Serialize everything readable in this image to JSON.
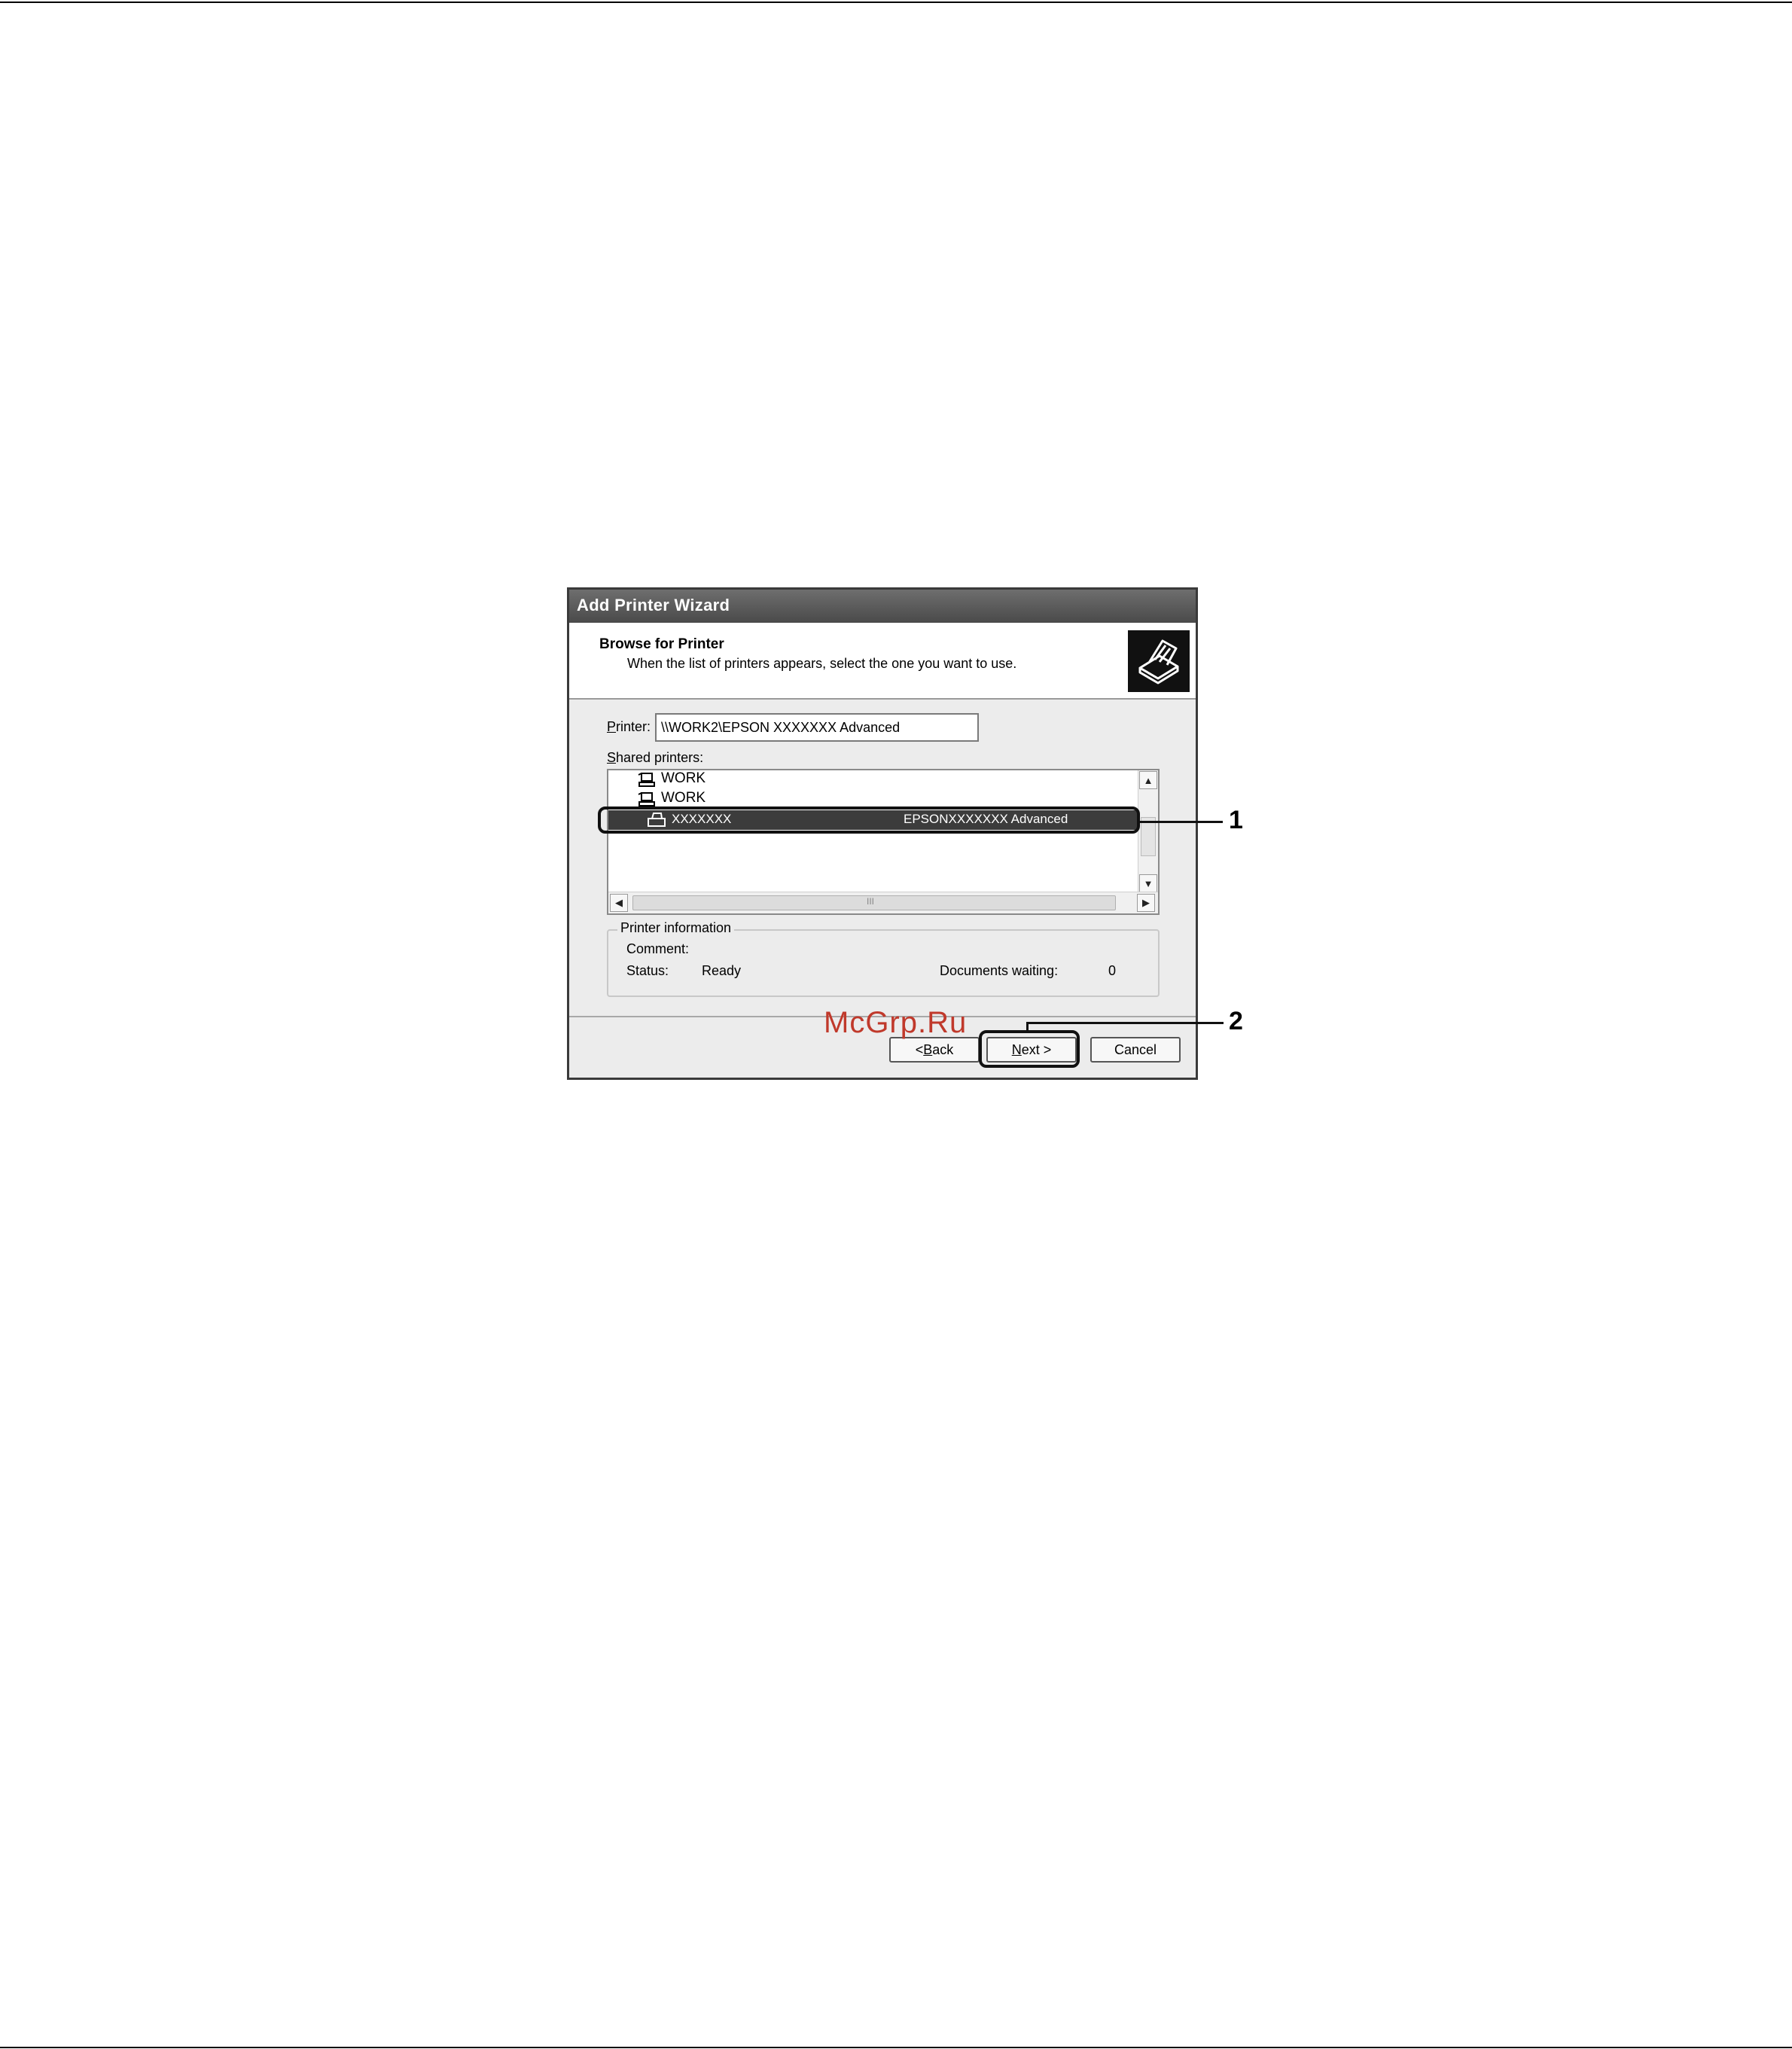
{
  "dialog": {
    "title": "Add Printer Wizard",
    "header_title": "Browse for Printer",
    "header_subtitle": "When the list of printers appears, select the one you want to use.",
    "header_icon": "printer-wizard-icon"
  },
  "printer_field": {
    "label_prefix": "",
    "label_accel": "P",
    "label_rest": "rinter:",
    "value": "\\\\WORK2\\EPSON XXXXXXX Advanced"
  },
  "shared_printers": {
    "label_accel": "S",
    "label_rest": "hared printers:",
    "items": [
      {
        "name": "WORK",
        "icon": "network-computer-icon"
      },
      {
        "name": "WORK",
        "icon": "network-computer-icon"
      }
    ],
    "selected": {
      "name": "XXXXXXX",
      "description": "EPSONXXXXXXX  Advanced",
      "icon": "printer-icon"
    },
    "scroll_hint": "III"
  },
  "printer_information": {
    "legend": "Printer information",
    "comment_label": "Comment:",
    "status_label": "Status:",
    "status_value": "Ready",
    "documents_label": "Documents waiting:",
    "documents_value": "0"
  },
  "buttons": {
    "back_prefix": "< ",
    "back_accel": "B",
    "back_rest": "ack",
    "next_accel": "N",
    "next_rest": "ext >",
    "cancel": "Cancel"
  },
  "callouts": {
    "one": "1",
    "two": "2"
  },
  "watermark": "McGrp.Ru",
  "colors": {
    "title_bar": "#4a4a4a",
    "selection": "#3c3c3c",
    "watermark": "#c0392b"
  }
}
